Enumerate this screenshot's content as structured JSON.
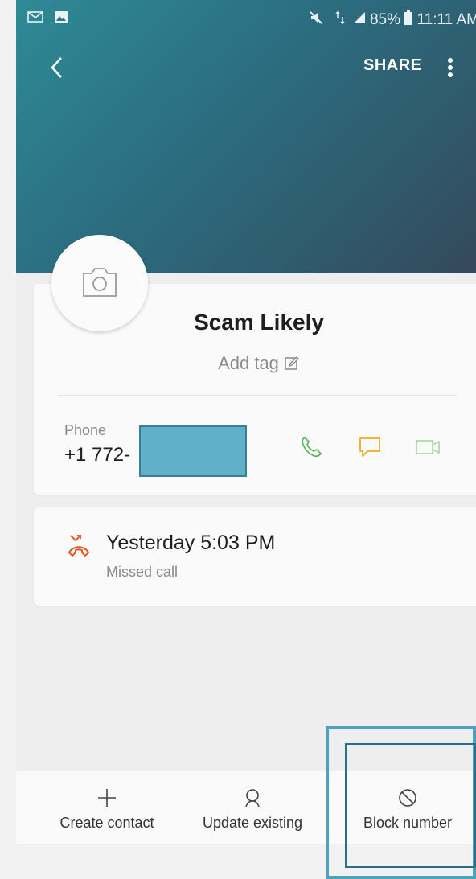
{
  "status_bar": {
    "left_icons": [
      "gmail-icon",
      "gallery-icon"
    ],
    "right_icons": [
      "mute-icon",
      "data-icon",
      "signal-icon",
      "battery-icon"
    ],
    "battery": "85%",
    "time": "11:11 AM"
  },
  "header": {
    "back_icon": "chevron-left-icon",
    "share_label": "SHARE",
    "more_icon": "more-vert-icon"
  },
  "contact": {
    "avatar_icon": "camera-icon",
    "name": "Scam Likely",
    "add_tag_label": "Add tag",
    "add_tag_icon": "edit-icon",
    "phone_label": "Phone",
    "phone_number": "+1 772-",
    "actions": [
      "call-icon",
      "message-icon",
      "video-call-icon"
    ],
    "colors": {
      "call": "#5cb85c",
      "message": "#f0ad1e",
      "video": "#a8dca8"
    }
  },
  "call_log": {
    "icon": "missed-call-icon",
    "time": "Yesterday 5:03 PM",
    "status": "Missed call",
    "color": "#e25a2a"
  },
  "bottom_bar": {
    "create_label": "Create contact",
    "update_label": "Update existing",
    "block_label": "Block number"
  },
  "colors": {
    "header_gradient_start": "#2e8a96",
    "header_gradient_end": "#34495a",
    "highlight": "#4da3be"
  }
}
